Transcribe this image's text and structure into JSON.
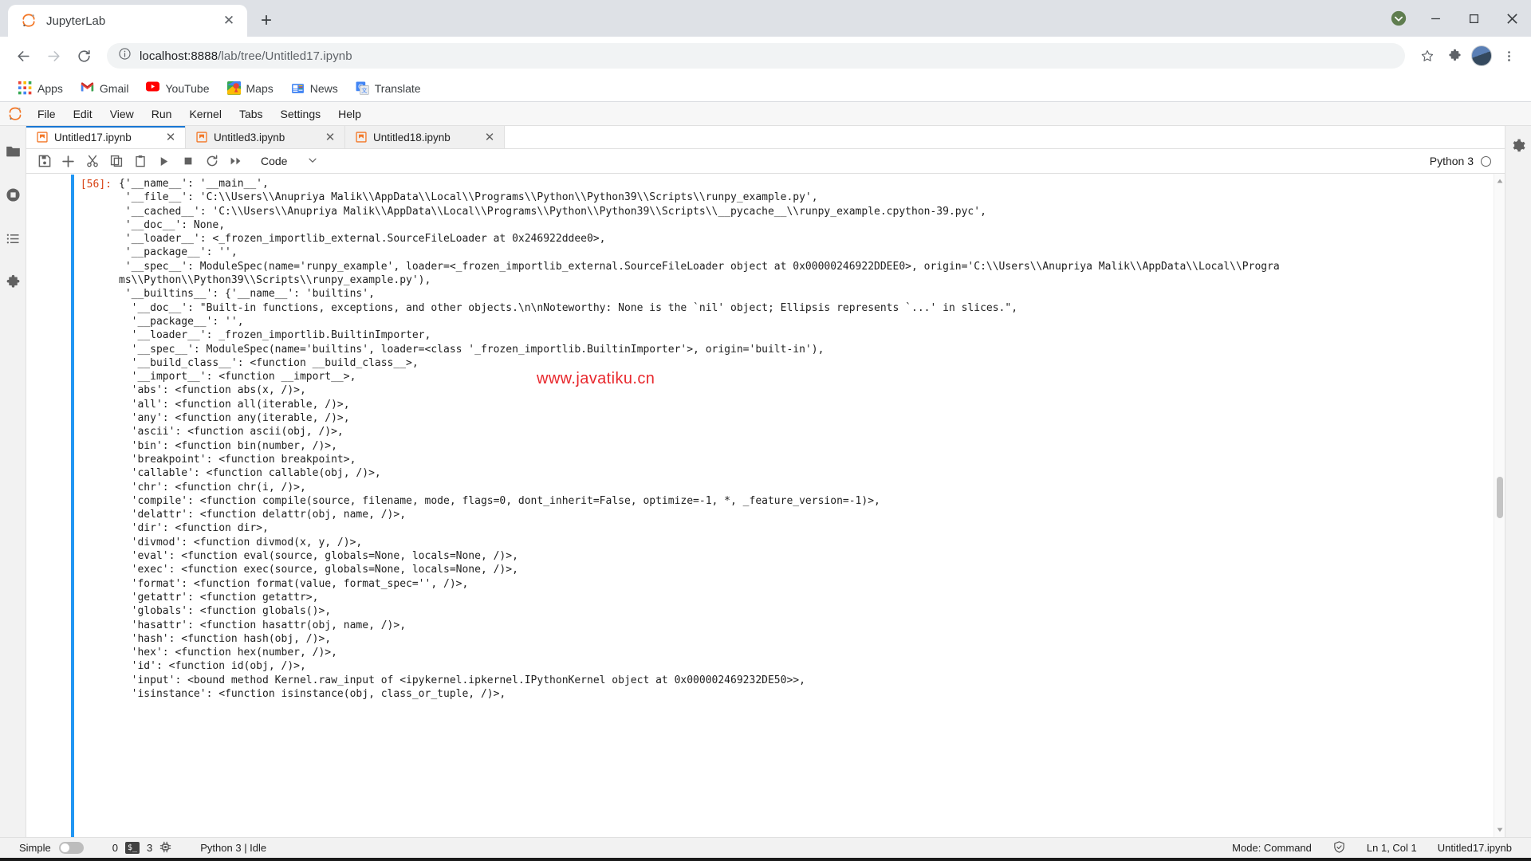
{
  "browser": {
    "tab": {
      "title": "JupyterLab",
      "favicon": "jupyter-logo-icon",
      "close": "✕"
    },
    "new_tab_label": "+",
    "window_controls": {
      "update": "update-chevron-icon",
      "minimize": "─",
      "maximize": "☐",
      "close": "✕"
    },
    "nav": {
      "back": "←",
      "forward": "→",
      "reload": "⟳"
    },
    "omnibox": {
      "info_icon": "site-info-icon",
      "host": "localhost:8888",
      "path": "/lab/tree/Untitled17.ipynb",
      "full_url": "localhost:8888/lab/tree/Untitled17.ipynb",
      "star": "☆"
    },
    "extensions_icon": "puzzle-piece-icon",
    "profile_icon": "user-avatar-icon",
    "menu_icon": "three-dot-menu-icon",
    "bookmarks": [
      {
        "label": "Apps",
        "icon": "apps-grid-icon"
      },
      {
        "label": "Gmail",
        "icon": "gmail-icon"
      },
      {
        "label": "YouTube",
        "icon": "youtube-icon"
      },
      {
        "label": "Maps",
        "icon": "google-maps-icon"
      },
      {
        "label": "News",
        "icon": "google-news-icon"
      },
      {
        "label": "Translate",
        "icon": "google-translate-icon"
      }
    ]
  },
  "jupyter": {
    "menu": [
      "File",
      "Edit",
      "View",
      "Run",
      "Kernel",
      "Tabs",
      "Settings",
      "Help"
    ],
    "left_sidebar": [
      {
        "name": "file-browser",
        "icon": "folder-icon"
      },
      {
        "name": "running-terminals",
        "icon": "stop-circle-icon"
      },
      {
        "name": "table-of-contents",
        "icon": "list-icon"
      },
      {
        "name": "extension-manager",
        "icon": "puzzle-piece-icon"
      }
    ],
    "right_sidebar": [
      {
        "name": "property-inspector",
        "icon": "gear-icon"
      }
    ],
    "doc_tabs": [
      {
        "label": "Untitled17.ipynb",
        "active": true,
        "close": "✕",
        "icon": "notebook-icon"
      },
      {
        "label": "Untitled3.ipynb",
        "active": false,
        "close": "✕",
        "icon": "notebook-icon"
      },
      {
        "label": "Untitled18.ipynb",
        "active": false,
        "close": "✕",
        "icon": "notebook-icon"
      }
    ],
    "toolbar": {
      "buttons": [
        {
          "name": "save-button",
          "icon": "save-disk-icon",
          "title": "Save"
        },
        {
          "name": "insert-cell-button",
          "icon": "plus-icon",
          "title": "Insert cell below"
        },
        {
          "name": "cut-cell-button",
          "icon": "scissors-icon",
          "title": "Cut cells"
        },
        {
          "name": "copy-cell-button",
          "icon": "copy-icon",
          "title": "Copy cells"
        },
        {
          "name": "paste-cell-button",
          "icon": "clipboard-icon",
          "title": "Paste cells"
        },
        {
          "name": "run-cell-button",
          "icon": "play-triangle-icon",
          "title": "Run"
        },
        {
          "name": "interrupt-kernel-button",
          "icon": "stop-square-icon",
          "title": "Interrupt"
        },
        {
          "name": "restart-kernel-button",
          "icon": "restart-circular-arrow-icon",
          "title": "Restart"
        },
        {
          "name": "restart-run-all-button",
          "icon": "fast-forward-icon",
          "title": "Restart and run all"
        }
      ],
      "cell_type": "Code",
      "cell_type_chevron": "⌄",
      "kernel_name": "Python 3",
      "kernel_indicator": "kernel-idle-circle-icon"
    },
    "cell": {
      "prompt": "[56]:",
      "output": "{'__name__': '__main__',\n '__file__': 'C:\\\\Users\\\\Anupriya Malik\\\\AppData\\\\Local\\\\Programs\\\\Python\\\\Python39\\\\Scripts\\\\runpy_example.py',\n '__cached__': 'C:\\\\Users\\\\Anupriya Malik\\\\AppData\\\\Local\\\\Programs\\\\Python\\\\Python39\\\\Scripts\\\\__pycache__\\\\runpy_example.cpython-39.pyc',\n '__doc__': None,\n '__loader__': <_frozen_importlib_external.SourceFileLoader at 0x246922ddee0>,\n '__package__': '',\n '__spec__': ModuleSpec(name='runpy_example', loader=<_frozen_importlib_external.SourceFileLoader object at 0x00000246922DDEE0>, origin='C:\\\\Users\\\\Anupriya Malik\\\\AppData\\\\Local\\\\Progra\nms\\\\Python\\\\Python39\\\\Scripts\\\\runpy_example.py'),\n '__builtins__': {'__name__': 'builtins',\n  '__doc__': \"Built-in functions, exceptions, and other objects.\\n\\nNoteworthy: None is the `nil' object; Ellipsis represents `...' in slices.\",\n  '__package__': '',\n  '__loader__': _frozen_importlib.BuiltinImporter,\n  '__spec__': ModuleSpec(name='builtins', loader=<class '_frozen_importlib.BuiltinImporter'>, origin='built-in'),\n  '__build_class__': <function __build_class__>,\n  '__import__': <function __import__>,\n  'abs': <function abs(x, /)>,\n  'all': <function all(iterable, /)>,\n  'any': <function any(iterable, /)>,\n  'ascii': <function ascii(obj, /)>,\n  'bin': <function bin(number, /)>,\n  'breakpoint': <function breakpoint>,\n  'callable': <function callable(obj, /)>,\n  'chr': <function chr(i, /)>,\n  'compile': <function compile(source, filename, mode, flags=0, dont_inherit=False, optimize=-1, *, _feature_version=-1)>,\n  'delattr': <function delattr(obj, name, /)>,\n  'dir': <function dir>,\n  'divmod': <function divmod(x, y, /)>,\n  'eval': <function eval(source, globals=None, locals=None, /)>,\n  'exec': <function exec(source, globals=None, locals=None, /)>,\n  'format': <function format(value, format_spec='', /)>,\n  'getattr': <function getattr>,\n  'globals': <function globals()>,\n  'hasattr': <function hasattr(obj, name, /)>,\n  'hash': <function hash(obj, /)>,\n  'hex': <function hex(number, /)>,\n  'id': <function id(obj, /)>,\n  'input': <bound method Kernel.raw_input of <ipykernel.ipkernel.IPythonKernel object at 0x000002469232DE50>>,\n  'isinstance': <function isinstance(obj, class_or_tuple, /)>,"
    },
    "watermark": "www.javatiku.cn",
    "watermark_color": "#e8282d",
    "status_bar": {
      "simple_label": "Simple",
      "simple_toggle_state": "off",
      "terminal_count": "0",
      "terminal_icon": "terminal-prompt-icon",
      "kernel_count": "3",
      "kernel_icon": "cpu-chip-icon",
      "kernel_status": "Python 3 | Idle",
      "mode": "Mode: Command",
      "trust_icon": "shield-check-icon",
      "cursor_position": "Ln 1, Col 1",
      "file_name": "Untitled17.ipynb"
    }
  },
  "theme": {
    "accent": "#1976d2",
    "jupyter_orange": "#f37726",
    "prompt_color": "#d84315",
    "cell_bar": "#2196f3"
  }
}
